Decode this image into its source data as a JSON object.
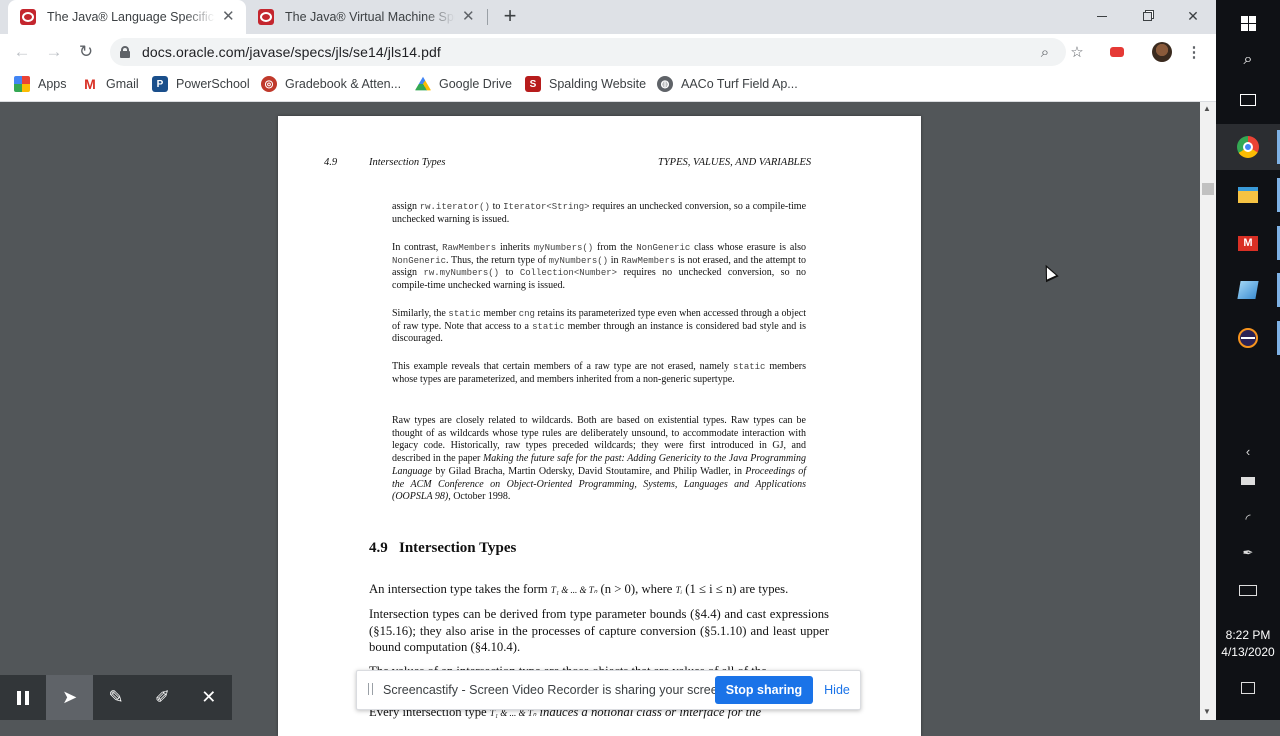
{
  "browser": {
    "tabs": [
      {
        "title": "The Java® Language Specificatio",
        "close": "✕"
      },
      {
        "title": "The Java® Virtual Machine Speci",
        "close": "✕"
      }
    ],
    "new_tab": "+",
    "url": "docs.oracle.com/javase/specs/jls/se14/jls14.pdf",
    "bookmarks": [
      {
        "label": "Apps"
      },
      {
        "label": "Gmail"
      },
      {
        "label": "PowerSchool"
      },
      {
        "label": "Gradebook & Atten..."
      },
      {
        "label": "Google Drive"
      },
      {
        "label": "Spalding Website"
      },
      {
        "label": "AACo Turf Field Ap..."
      }
    ]
  },
  "pdf": {
    "header": {
      "section_no": "4.9",
      "section_title": "Intersection Types",
      "chapter": "TYPES, VALUES, AND VARIABLES"
    },
    "paragraphs": {
      "p1": {
        "t1": "assign",
        "c1": "rw.iterator()",
        "t2": "to",
        "c2": "Iterator<String>",
        "t3": "requires an unchecked conversion, so a compile-time unchecked warning is issued."
      },
      "p2": {
        "t1": "In contrast,",
        "c1": "RawMembers",
        "t2": "inherits",
        "c2": "myNumbers()",
        "t3": "from the",
        "c3": "NonGeneric",
        "t4": "class whose erasure is also",
        "c4": "NonGeneric",
        "t5": ". Thus, the return type of",
        "c5": "myNumbers()",
        "t6": "in",
        "c6": "RawMembers",
        "t7": "is not erased, and the attempt to assign",
        "c7": "rw.myNumbers()",
        "t8": "to",
        "c8": "Collection<Number>",
        "t9": "requires no unchecked conversion, so no compile-time unchecked warning is issued."
      },
      "p3": {
        "t1": "Similarly, the",
        "c1": "static",
        "t2": "member",
        "c2": "cng",
        "t3": "retains its parameterized type even when accessed through a object of raw type. Note that access to a",
        "c3": "static",
        "t4": "member through an instance is considered bad style and is discouraged."
      },
      "p4": {
        "t1": "This example reveals that certain members of a raw type are not erased, namely",
        "c1": "static",
        "t2": "members whose types are parameterized, and members inherited from a non-generic supertype."
      },
      "p5": {
        "t1": "Raw types are closely related to wildcards. Both are based on existential types. Raw types can be thought of as wildcards whose type rules are deliberately unsound, to accommodate interaction with legacy code. Historically, raw types preceded wildcards; they were first introduced in GJ, and described in the paper",
        "i1": "Making the future safe for the past: Adding Genericity to the Java Programming Language",
        "t2": "by Gilad Bracha, Martin Odersky, David Stoutamire, and Philip Wadler, in",
        "i2": "Proceedings of the ACM Conference on Object-Oriented Programming, Systems, Languages and Applications (OOPSLA 98)",
        "t3": ", October 1998."
      }
    },
    "section_heading": "4.9   Intersection Types",
    "body": {
      "b1": {
        "t1": "An intersection type takes the form",
        "m1": "T₁ & ... & Tₙ",
        "t2": "(n > 0), where",
        "m2": "Tᵢ",
        "t3": "(1 ≤ i ≤ n) are types."
      },
      "b2": "Intersection types can be derived from type parameter bounds (§4.4) and cast expressions (§15.16); they also arise in the processes of capture conversion (§5.1.10) and least upper bound computation (§4.10.4).",
      "b3": "The values of an intersection type are those objects that are values of all of the",
      "b4": {
        "t1": "Every intersection type",
        "m1": "T₁ & ... & Tₙ",
        "t2": "induces a notional class or interface for the"
      }
    }
  },
  "screencastify": {
    "message": "Screencastify - Screen Video Recorder is sharing your screen.",
    "stop_label": "Stop sharing",
    "hide_label": "Hide"
  },
  "taskbar": {
    "time": "8:22 PM",
    "date": "4/13/2020"
  }
}
